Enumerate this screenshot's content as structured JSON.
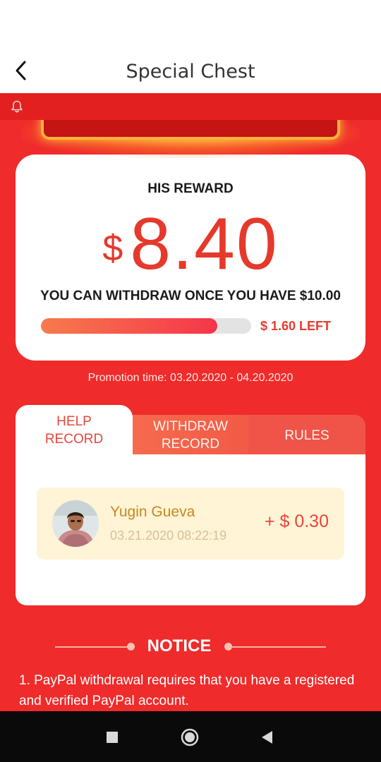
{
  "header": {
    "title": "Special Chest"
  },
  "reward": {
    "label": "HIS REWARD",
    "currency": "$",
    "amount": "8.40",
    "withdraw_note": "YOU CAN WITHDRAW ONCE YOU HAVE $10.00",
    "progress_fraction": 0.84,
    "left_label": "$ 1.60 LEFT"
  },
  "promotion_time": "Promotion time: 03.20.2020 - 04.20.2020",
  "tabs": [
    {
      "label_line1": "HELP",
      "label_line2": "RECORD",
      "active": true
    },
    {
      "label_line1": "WITHDRAW",
      "label_line2": "RECORD",
      "active": false
    },
    {
      "label_line1": "RULES",
      "label_line2": "",
      "active": false
    }
  ],
  "records": [
    {
      "name": "Yugin Gueva",
      "time": "03.21.2020 08:22:19",
      "amount": "+ $ 0.30"
    }
  ],
  "notice": {
    "title": "NOTICE",
    "text": "1. PayPal withdrawal requires that you have a registered and verified PayPal account."
  },
  "icons": {
    "back": "chevron-left-icon",
    "bell": "bell-icon",
    "nav_recents": "square-icon",
    "nav_home": "circle-icon",
    "nav_back": "triangle-icon"
  },
  "colors": {
    "primary_red": "#ef2b2b",
    "accent_red": "#e5392c",
    "record_bg": "#fff4d6",
    "record_name": "#c8871e"
  }
}
